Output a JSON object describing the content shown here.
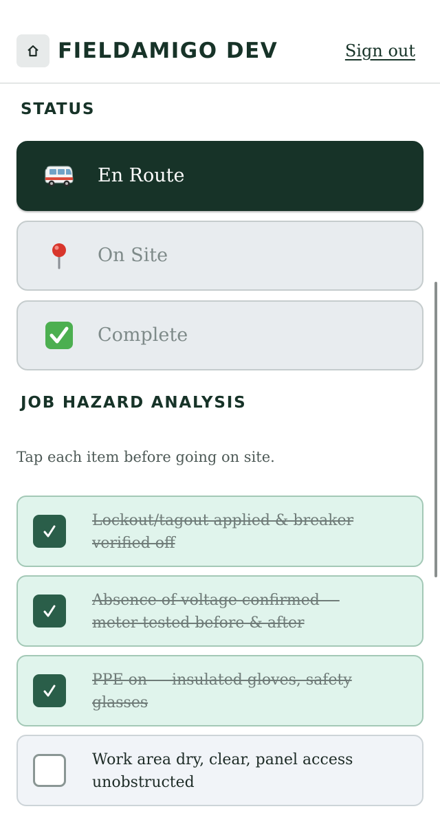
{
  "header": {
    "title": "FIELDAMIGO DEV",
    "signout_label": "Sign out",
    "home_icon": "home-icon"
  },
  "status": {
    "heading": "STATUS",
    "options": [
      {
        "label": "En Route",
        "icon": "van-icon",
        "selected": true
      },
      {
        "label": "On Site",
        "icon": "pushpin-icon",
        "selected": false
      },
      {
        "label": "Complete",
        "icon": "check-mark-button-icon",
        "selected": false
      }
    ]
  },
  "jha": {
    "heading": "JOB HAZARD ANALYSIS",
    "helper": "Tap each item before going on site.",
    "items": [
      {
        "line1": "Lockout/tagout applied & breaker",
        "line2": "verified off",
        "checked": true
      },
      {
        "line1": "Absence of voltage confirmed —",
        "line2": "meter tested before & after",
        "checked": true
      },
      {
        "line1": "PPE on — insulated gloves, safety",
        "line2": "glasses",
        "checked": true
      },
      {
        "line1": "Work area dry, clear, panel access",
        "line2": "unobstructed",
        "checked": false
      }
    ]
  },
  "colors": {
    "brand_dark": "#173328",
    "checked_bg": "#e0f4ec",
    "checkbox_fill": "#2a5e49",
    "inactive_bg": "#e8ecef"
  }
}
